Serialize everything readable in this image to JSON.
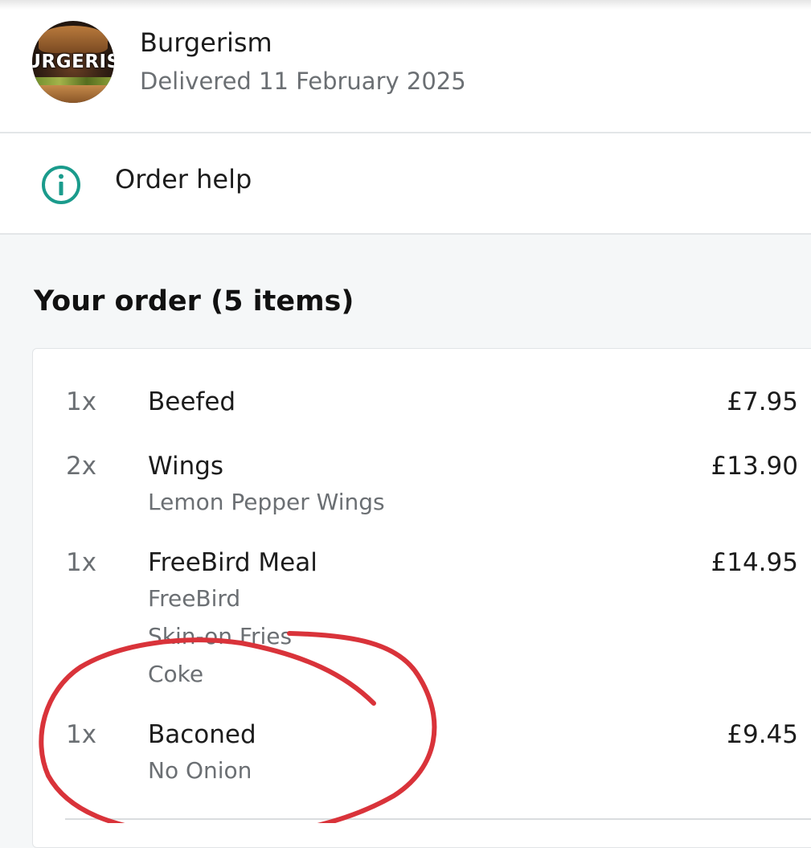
{
  "restaurant": {
    "name": "Burgerism",
    "status": "Delivered 11 February 2025",
    "logo_text": "URGERIS"
  },
  "order_help": {
    "label": "Order help",
    "icon": "info-icon"
  },
  "order": {
    "title": "Your order (5 items)",
    "items": [
      {
        "qty": "1x",
        "name": "Beefed",
        "price": "£7.95",
        "options": []
      },
      {
        "qty": "2x",
        "name": "Wings",
        "price": "£13.90",
        "options": [
          "Lemon Pepper Wings"
        ]
      },
      {
        "qty": "1x",
        "name": "FreeBird Meal",
        "price": "£14.95",
        "options": [
          "FreeBird",
          "Skin-on Fries",
          "Coke"
        ]
      },
      {
        "qty": "1x",
        "name": "Baconed",
        "price": "£9.45",
        "options": [
          "No Onion"
        ]
      }
    ]
  },
  "colors": {
    "accent": "#1a9b8c",
    "annotation": "#d9333a",
    "page_background": "#f5f7f8",
    "muted_text": "#6b6f73"
  }
}
